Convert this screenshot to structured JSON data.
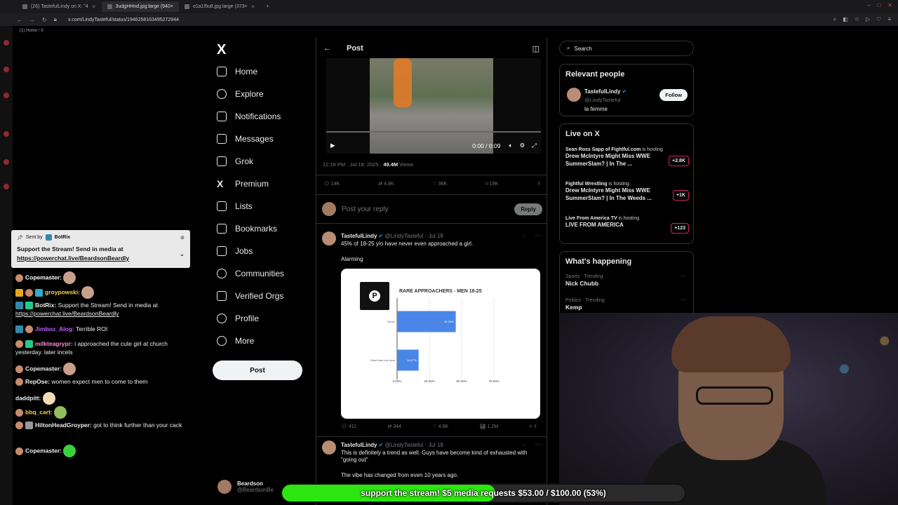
{
  "browser": {
    "tabs": [
      {
        "label": "(26) TastefulLindy on X: \"4"
      },
      {
        "label": "3udgHHnd.jpg:large (940×"
      },
      {
        "label": "o1a1l5u8.jpg:large (373×"
      }
    ],
    "url": "x.com/LindyTasteful/status/1946258163495272944",
    "breadcrumb": "(1) Home / X"
  },
  "chat": {
    "pinned": {
      "sent_by": "Sent by",
      "sender": "BotRix",
      "message": "Support the Stream! Send in media at",
      "link": "https://powerchat.live/BeardsonBeardly"
    },
    "messages": [
      {
        "user": "Copemaster:",
        "text": "",
        "color": "#ffffff"
      },
      {
        "user": "groypowski:",
        "text": "",
        "color": "#ffd23f"
      },
      {
        "user": "BotRix:",
        "text": " Support the Stream! Send in media at",
        "link": "https://powerchat.live/BeardsonBeardly",
        "color": "#ffffff"
      },
      {
        "user": "Jimboz_Alog:",
        "text": " Terrible ROI",
        "color": "#c060ff"
      },
      {
        "user": "milkteagrypr:",
        "text": " i approached the cute girl at church yesterday. later incels",
        "color": "#ff8ad8"
      },
      {
        "user": "Copemaster:",
        "text": "",
        "color": "#ffffff"
      },
      {
        "user": "RepOse:",
        "text": " women expect men to come to them",
        "color": "#ffffff"
      },
      {
        "user": "daddpitt:",
        "text": "",
        "color": "#ffffff"
      },
      {
        "user": "bbq_cart:",
        "text": "",
        "color": "#ffd23f"
      },
      {
        "user": "HiltonHeadGroyper:",
        "text": " got to think further than your cack",
        "color": "#ffffff"
      },
      {
        "user": "Copemaster:",
        "text": "",
        "color": "#ffffff"
      }
    ]
  },
  "nav": {
    "logo": "X",
    "items": [
      "Home",
      "Explore",
      "Notifications",
      "Messages",
      "Grok",
      "Premium",
      "Lists",
      "Bookmarks",
      "Jobs",
      "Communities",
      "Verified Orgs",
      "Profile",
      "More"
    ],
    "post_label": "Post",
    "account_name": "Beardson",
    "account_handle": "@BeardsonBe"
  },
  "post": {
    "header": "Post",
    "video_time": "0:00 / 0:09",
    "timestamp": "12:18 PM · Jul 18, 2025 · ",
    "views": "49.4M",
    "views_label": " Views",
    "counts": {
      "replies": "14K",
      "reposts": "4.9K",
      "likes": "36K",
      "bookmarks": "19K"
    },
    "reply_placeholder": "Post your reply",
    "reply_button": "Reply"
  },
  "tweets": [
    {
      "name": "TastefulLindy",
      "handle": "@LindyTasteful · Jul 18",
      "text": "45% of 18-25 y/o have never even approached a girl.",
      "subtext": "Alarming",
      "counts": {
        "replies": "411",
        "reposts": "344",
        "likes": "4.8K",
        "views": "1.2M"
      }
    },
    {
      "name": "TastefulLindy",
      "handle": "@LindyTasteful · Jul 18",
      "text": "This is definitely a trend as well. Guys have become kind of exhausted with \"going out\"",
      "subtext": "The vibe has changed from even 10 years ago."
    }
  ],
  "chart_data": {
    "type": "bar",
    "orientation": "horizontal",
    "title": "RARE APPROACHERS - MEN 18-25",
    "categories": [
      "Never",
      "More than one year"
    ],
    "values": [
      45.45,
      16.67
    ],
    "data_labels": [
      "45.45%",
      "16.67%"
    ],
    "xticks": [
      "0.00%",
      "25.00%",
      "50.00%",
      "75.00%"
    ],
    "xlim": [
      0,
      75
    ],
    "bar_color": "#4a86e8"
  },
  "right": {
    "search_placeholder": "Search",
    "relevant_title": "Relevant people",
    "person": {
      "name": "TastefulLindy",
      "handle": "@LindyTasteful",
      "bio": "la femme",
      "follow": "Follow"
    },
    "live_title": "Live on X",
    "live": [
      {
        "host": "Sean Ross Sapp of Fightful.com",
        "hosting": " is hosting",
        "title": "Drew McIntyre Might Miss WWE SummerSlam? | In The ...",
        "count": "+2.8K"
      },
      {
        "host": "Fightful Wrestling",
        "hosting": " is hosting",
        "title": "Drew McIntyre Might Miss WWE SummerSlam? | In The Weeds ...",
        "count": "+1K"
      },
      {
        "host": "Live From America TV",
        "hosting": " is hosting",
        "title": "LIVE FROM AMERICA",
        "count": "+123"
      }
    ],
    "happening_title": "What's happening",
    "trends": [
      {
        "category": "Sports · Trending",
        "name": "Nick Chubb"
      },
      {
        "category": "Politics · Trending",
        "name": "Kemp"
      }
    ]
  },
  "goal": {
    "text": "support the stream! $5 media requests $53.00 / $100.00 (53%)",
    "progress": 0.53,
    "color": "#2ee60f"
  }
}
